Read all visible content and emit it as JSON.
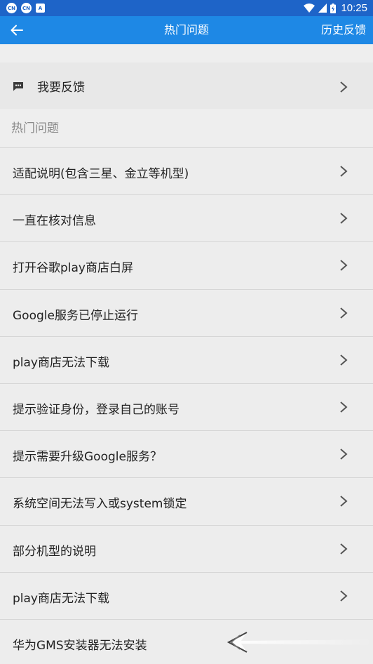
{
  "status_bar": {
    "notification_icons": [
      "CN",
      "CN",
      "A"
    ],
    "time": "10:25"
  },
  "header": {
    "title": "热门问题",
    "history_label": "历史反馈"
  },
  "feedback": {
    "label": "我要反馈"
  },
  "section": {
    "title": "热门问题"
  },
  "questions": [
    {
      "label": "适配说明(包含三星、金立等机型)"
    },
    {
      "label": "一直在核对信息"
    },
    {
      "label": "打开谷歌play商店白屏"
    },
    {
      "label": "Google服务已停止运行"
    },
    {
      "label": "play商店无法下载"
    },
    {
      "label": "提示验证身份，登录自己的账号"
    },
    {
      "label": "提示需要升级Google服务？"
    },
    {
      "label": "系统空间无法写入或system锁定"
    },
    {
      "label": "部分机型的说明"
    },
    {
      "label": "play商店无法下载"
    },
    {
      "label": "华为GMS安装器无法安装"
    }
  ],
  "colors": {
    "status_bar": "#1e64c8",
    "app_bar": "#1e88e5",
    "background": "#eeeeee"
  }
}
